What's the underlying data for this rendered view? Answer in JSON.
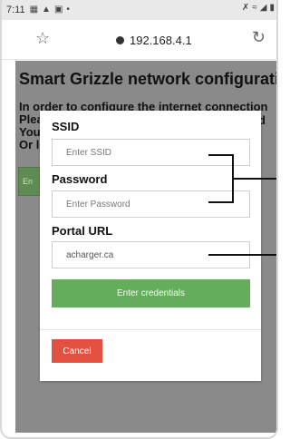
{
  "status_bar": {
    "time": "7:11",
    "left_icons": [
      "gallery-icon",
      "warning-icon",
      "screenshot-icon",
      "dot-icon"
    ],
    "right_icons": [
      "mute-icon",
      "wifi-icon",
      "signal-icon",
      "battery-icon"
    ]
  },
  "browser": {
    "url": "192.168.4.1"
  },
  "page": {
    "title": "Smart Grizzle network configuration",
    "intro_lines": [
      "In order to configure the internet connection",
      "Plea",
      "You",
      "Or le"
    ],
    "intro_tail": "d",
    "bg_button_label": "En"
  },
  "modal": {
    "ssid": {
      "label": "SSID",
      "placeholder": "Enter SSID",
      "value": ""
    },
    "password": {
      "label": "Password",
      "placeholder": "Enter Password",
      "value": ""
    },
    "portal": {
      "label": "Portal URL",
      "placeholder": "",
      "value": "acharger.ca"
    },
    "submit_label": "Enter credentials",
    "cancel_label": "Cancel"
  },
  "colors": {
    "submit": "#64ad5a",
    "cancel": "#e0513f",
    "overlay": "#8a8a8a"
  }
}
